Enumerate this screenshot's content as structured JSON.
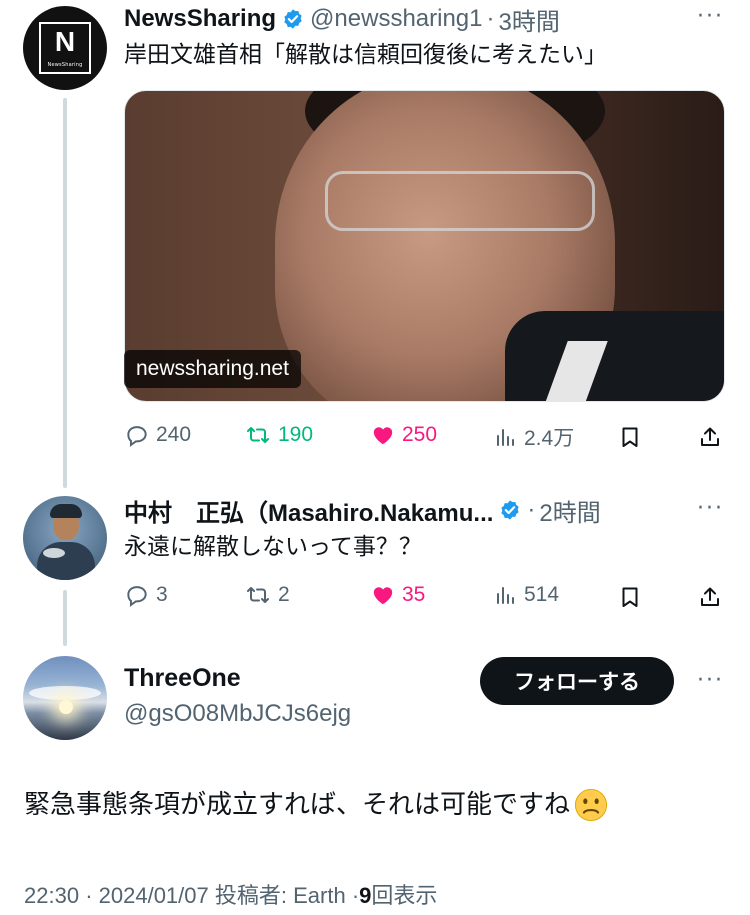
{
  "tweet1": {
    "author_name": "NewsSharing",
    "avatar_letter": "N",
    "avatar_sub": "NewsSharing",
    "handle": "@newssharing1",
    "separator": "·",
    "time": "3時間",
    "more": "···",
    "text": "岸田文雄首相「解散は信頼回復後に考えたい」",
    "media_source": "newssharing.net",
    "stats": {
      "replies": "240",
      "retweets": "190",
      "likes": "250",
      "views": "2.4万"
    }
  },
  "tweet2": {
    "author_name": "中村　正弘（Masahiro.Nakamu...",
    "separator": "·",
    "time": "2時間",
    "more": "···",
    "text": "永遠に解散しないって事？？",
    "stats": {
      "replies": "3",
      "retweets": "2",
      "likes": "35",
      "views": "514"
    }
  },
  "tweet3": {
    "author_name": "ThreeOne",
    "handle": "@gsO08MbJCJs6ejg",
    "follow_label": "フォローする",
    "more": "···",
    "text": "緊急事態条項が成立すれば、それは可能ですね",
    "emoji": "frowning-face",
    "meta": {
      "time": "22:30",
      "separator": "·",
      "date": "2024/01/07",
      "poster_label": "投稿者: Earth",
      "views_count": "9",
      "views_label": "回表示"
    }
  },
  "colors": {
    "verified": "#1d9bf0",
    "retweet": "#00ba7c",
    "like": "#f91880",
    "secondary_text": "#536471",
    "thread_line": "#cfd9de"
  }
}
